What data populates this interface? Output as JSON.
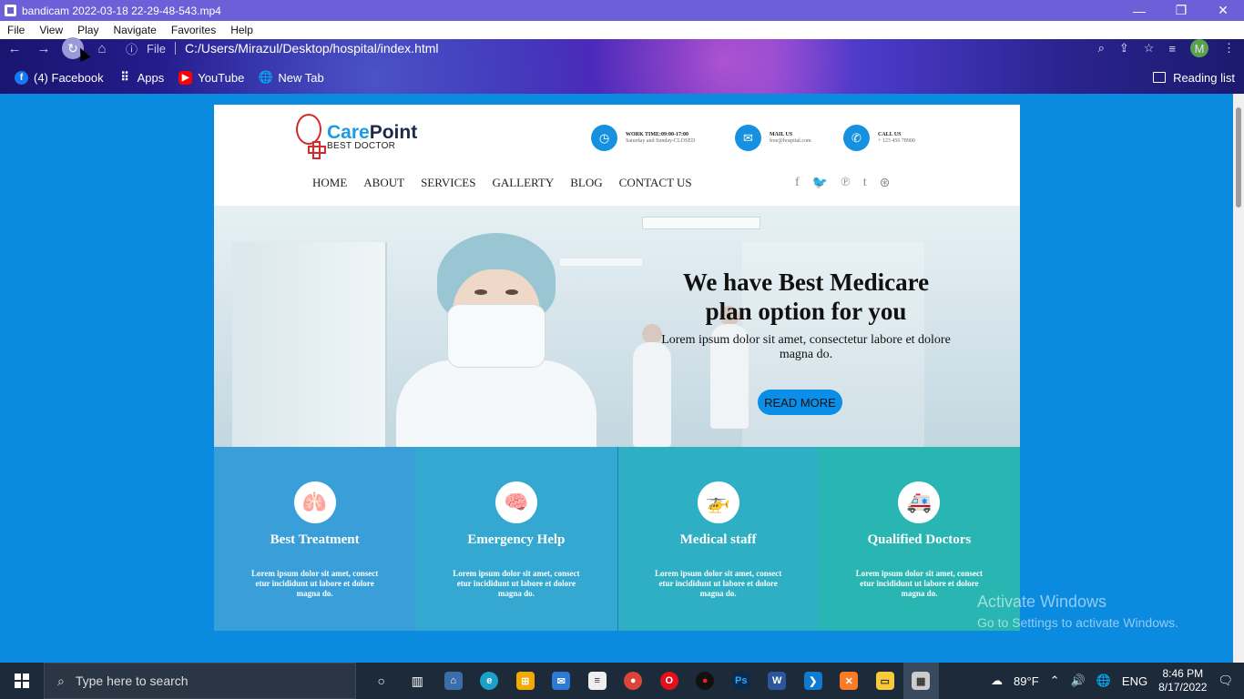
{
  "window": {
    "title": "bandicam 2022-03-18 22-29-48-543.mp4",
    "controls": [
      "—",
      "❐",
      "✕"
    ]
  },
  "player_menu": [
    "File",
    "View",
    "Play",
    "Navigate",
    "Favorites",
    "Help"
  ],
  "browser": {
    "address_prefix": "File",
    "url": "C:/Users/Mirazul/Desktop/hospital/index.html",
    "profile_initial": "M",
    "bookmarks": [
      {
        "label": "(4) Facebook",
        "icon": "facebook-icon",
        "color": "#1877f2"
      },
      {
        "label": "Apps",
        "icon": "apps-grid-icon",
        "color": "#ffffff"
      },
      {
        "label": "YouTube",
        "icon": "youtube-icon",
        "color": "#ff0000"
      },
      {
        "label": "New Tab",
        "icon": "globe-icon",
        "color": "#ffffff"
      }
    ],
    "reading_list": "Reading list"
  },
  "site": {
    "brand_part1": "Care",
    "brand_part2": "Point",
    "tagline": "BEST DOCTOR",
    "contacts": [
      {
        "label": "WORK TIME:09:00-17:00",
        "value": "Saturday and Sunday-CLOSED",
        "icon": "clock-icon"
      },
      {
        "label": "MAIL US",
        "value": "free@hospital.com",
        "icon": "mail-icon"
      },
      {
        "label": "CALL US",
        "value": "+ 123 456 78900",
        "icon": "phone-icon"
      }
    ],
    "nav": [
      "HOME",
      "ABOUT",
      "SERVICES",
      "GALLERTY",
      "BLOG",
      "CONTACT US"
    ],
    "social": [
      {
        "icon": "facebook-icon",
        "glyph": "f"
      },
      {
        "icon": "twitter-icon",
        "glyph": "🐦"
      },
      {
        "icon": "pinterest-icon",
        "glyph": "℗"
      },
      {
        "icon": "tumblr-icon",
        "glyph": "t"
      },
      {
        "icon": "dribbble-icon",
        "glyph": "⊛"
      }
    ],
    "hero": {
      "heading": "We have Best Medicare plan option for you",
      "text": "Lorem ipsum dolor sit amet, consectetur labore et dolore magna do.",
      "button": "READ MORE"
    },
    "features": [
      {
        "title": "Best Treatment",
        "text": "Lorem ipsum dolor sit amet, consect etur incididunt ut labore et dolore magna do.",
        "icon": "lungs-icon",
        "color": "#3a9fd9"
      },
      {
        "title": "Emergency Help",
        "text": "Lorem ipsum dolor sit amet, consect etur incididunt ut labore et dolore magna do.",
        "icon": "brain-icon",
        "color": "#34a8d0"
      },
      {
        "title": "Medical staff",
        "text": "Lorem ipsum dolor sit amet, consect etur incididunt ut labore et dolore magna do.",
        "icon": "helicopter-icon",
        "color": "#2eafc4"
      },
      {
        "title": "Qualified Doctors",
        "text": "Lorem ipsum dolor sit amet, consect etur incididunt ut labore et dolore magna do.",
        "icon": "ambulance-icon",
        "color": "#29b6b3"
      }
    ]
  },
  "watermark": {
    "line1": "Activate Windows",
    "line2": "Go to Settings to activate Windows."
  },
  "taskbar": {
    "search_placeholder": "Type here to search",
    "weather": "89°F",
    "language": "ENG",
    "time": "8:46 PM",
    "date": "8/17/2022"
  }
}
